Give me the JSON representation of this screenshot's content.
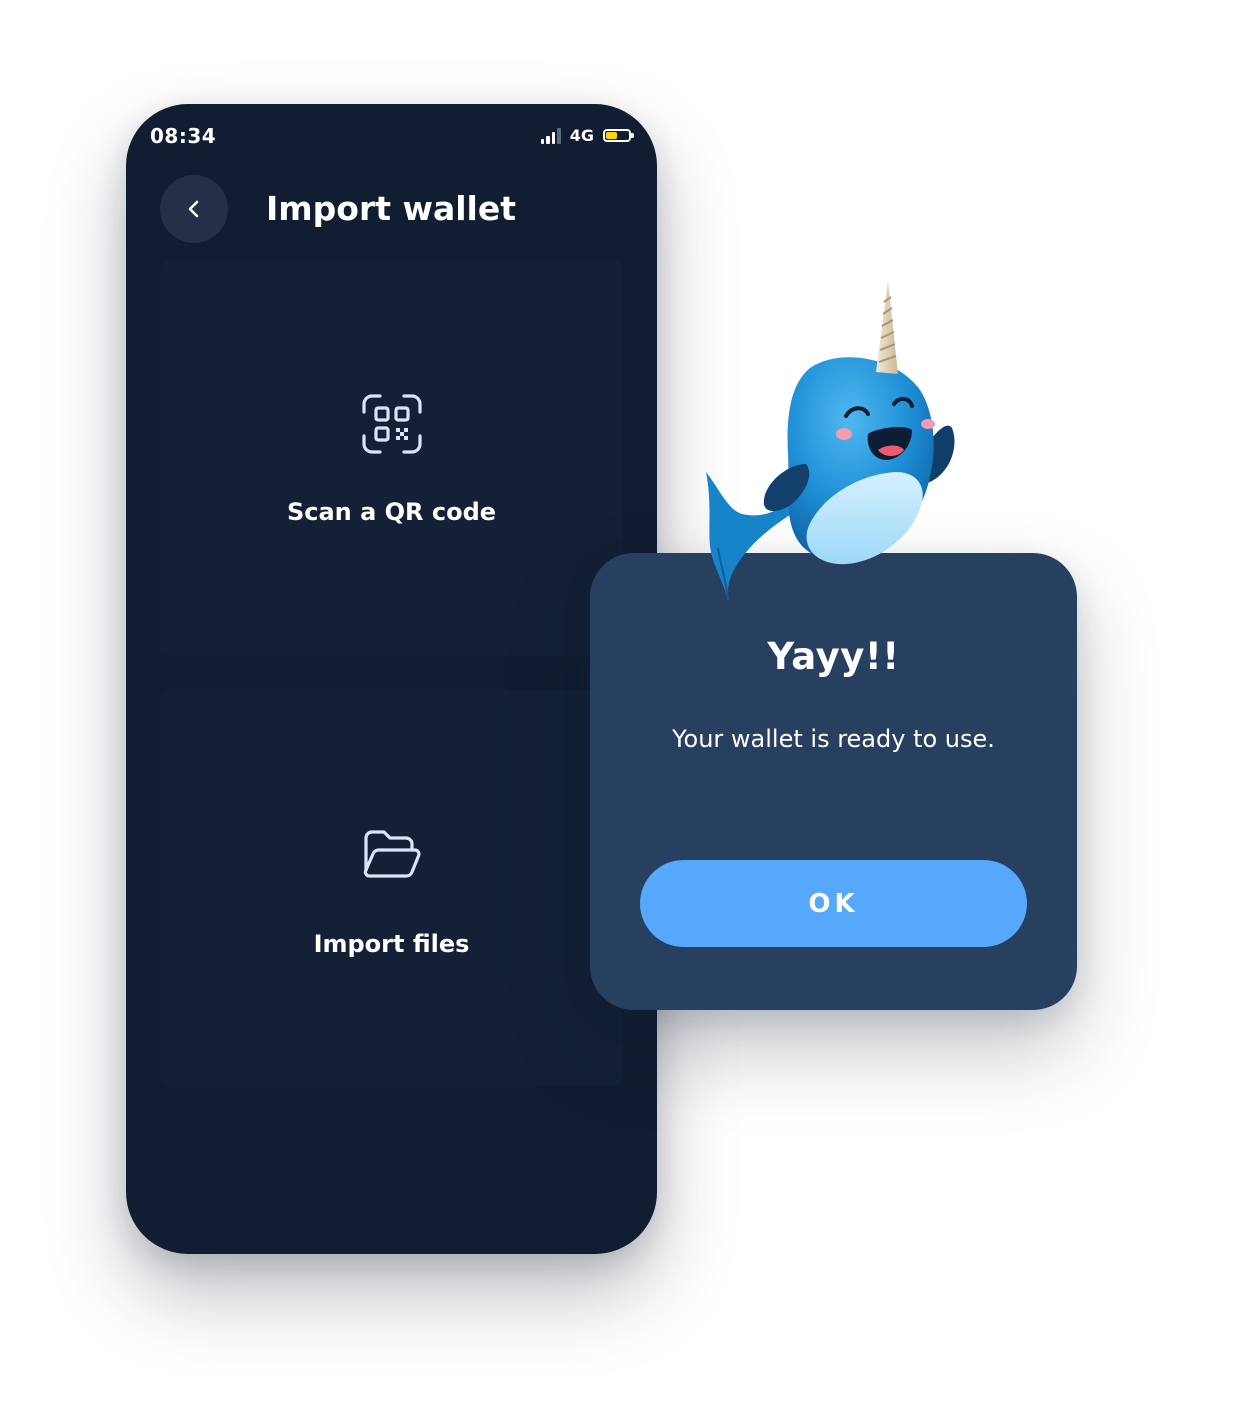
{
  "status_bar": {
    "time": "08:34",
    "network": "4G",
    "signal_icon": "signal-bars-icon",
    "battery_icon": "battery-icon",
    "battery_level": 0.55,
    "battery_color": "#f5d90a"
  },
  "header": {
    "back_icon": "chevron-left-icon",
    "title": "Import wallet"
  },
  "options": [
    {
      "icon": "qr-scan-icon",
      "label": "Scan a QR code"
    },
    {
      "icon": "folder-open-icon",
      "label": "Import files"
    }
  ],
  "dialog": {
    "title": "Yayy!!",
    "message": "Your wallet is ready to use.",
    "ok_label": "OK",
    "mascot": "narwhal-mascot"
  },
  "colors": {
    "phone_bg": "#111d30",
    "card_bg": "#132036",
    "dialog_bg": "#28405f",
    "accent": "#56a8fd",
    "icon_stroke": "#dce6f3"
  }
}
